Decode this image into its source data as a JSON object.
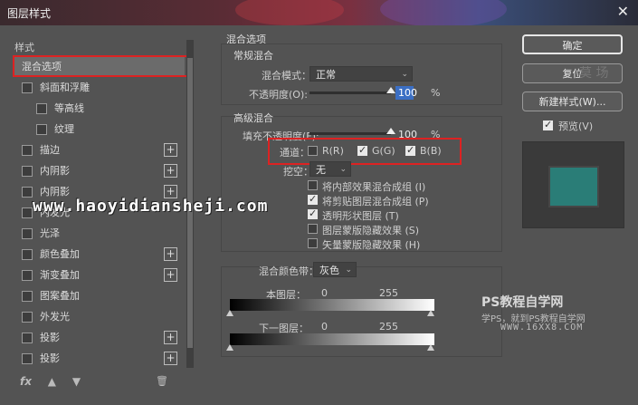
{
  "window": {
    "title": "图层样式",
    "close_icon": "close-icon"
  },
  "left": {
    "section_label": "样式",
    "items": [
      {
        "label": "混合选项",
        "checkbox": false,
        "plus": false,
        "selected": true
      },
      {
        "label": "斜面和浮雕",
        "checkbox": true,
        "plus": false
      },
      {
        "label": "等高线",
        "checkbox": true,
        "plus": false,
        "indent": true
      },
      {
        "label": "纹理",
        "checkbox": true,
        "plus": false,
        "indent": true
      },
      {
        "label": "描边",
        "checkbox": true,
        "plus": true
      },
      {
        "label": "内阴影",
        "checkbox": true,
        "plus": true
      },
      {
        "label": "内阴影",
        "checkbox": true,
        "plus": true
      },
      {
        "label": "内发光",
        "checkbox": true,
        "plus": false
      },
      {
        "label": "光泽",
        "checkbox": true,
        "plus": false
      },
      {
        "label": "颜色叠加",
        "checkbox": true,
        "plus": true
      },
      {
        "label": "渐变叠加",
        "checkbox": true,
        "plus": true
      },
      {
        "label": "图案叠加",
        "checkbox": true,
        "plus": false
      },
      {
        "label": "外发光",
        "checkbox": true,
        "plus": false
      },
      {
        "label": "投影",
        "checkbox": true,
        "plus": true
      },
      {
        "label": "投影",
        "checkbox": true,
        "plus": true
      }
    ],
    "footer": {
      "fx": "fx",
      "up": "▲",
      "down": "▼",
      "trash": "🗑"
    }
  },
  "blend": {
    "group_title": "混合选项",
    "general": {
      "title": "常规混合",
      "mode_label": "混合模式：",
      "mode_value": "正常",
      "opacity_label": "不透明度(O):",
      "opacity_value": "100",
      "opacity_fraction": 1.0,
      "pct": "%"
    },
    "advanced": {
      "title": "高级混合",
      "fill_label": "填充不透明度(F):",
      "fill_value": "100",
      "fill_fraction": 1.0,
      "pct": "%",
      "channels_label": "通道：",
      "channels": [
        {
          "label": "R(R)",
          "checked": false
        },
        {
          "label": "G(G)",
          "checked": true
        },
        {
          "label": "B(B)",
          "checked": true
        }
      ],
      "knockout_label": "挖空：",
      "knockout_value": "无",
      "options": [
        {
          "label": "将内部效果混合成组 (I)",
          "checked": false
        },
        {
          "label": "将剪贴图层混合成组 (P)",
          "checked": true
        },
        {
          "label": "透明形状图层 (T)",
          "checked": true
        },
        {
          "label": "图层蒙版隐藏效果 (S)",
          "checked": false
        },
        {
          "label": "矢量蒙版隐藏效果 (H)",
          "checked": false
        }
      ]
    },
    "blend_if": {
      "label": "混合颜色带：",
      "value": "灰色",
      "this_layer_label": "本图层：",
      "this_min": "0",
      "this_max": "255",
      "under_layer_label": "下一图层：",
      "under_min": "0",
      "under_max": "255"
    }
  },
  "right": {
    "ok": "确定",
    "reset": "复位",
    "new_style": "新建样式(W)...",
    "preview_label": "预览(V)",
    "preview_checked": true,
    "preview_color": "#2a7d77"
  },
  "watermarks": {
    "url": "www.haoyidiansheji.com",
    "ps_title": "PS教程自学网",
    "ps_sub": "学PS，就到PS教程自学网",
    "ps_site": "WWW.16XX8.COM",
    "top_right": "莫 场"
  }
}
